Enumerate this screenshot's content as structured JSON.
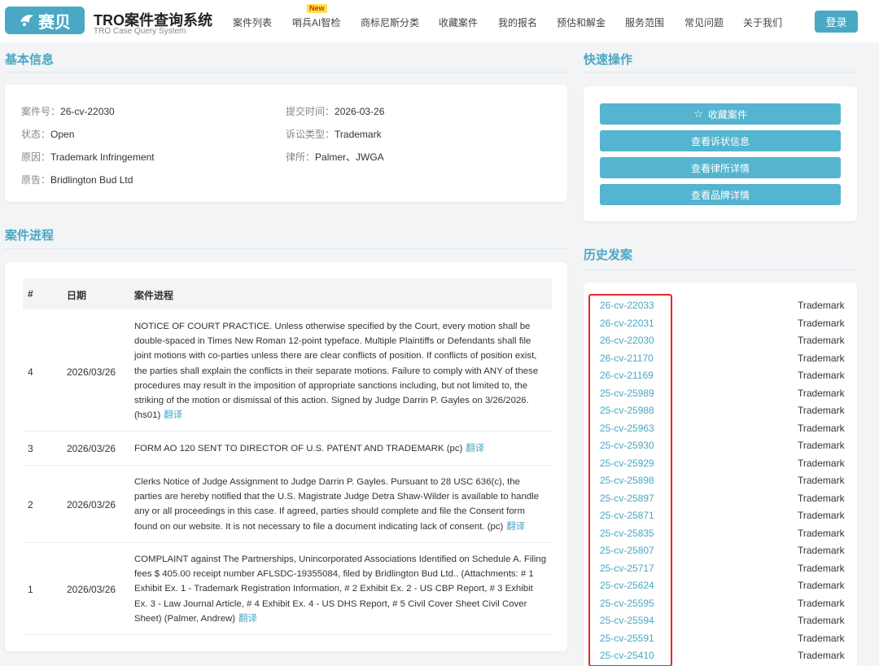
{
  "brand": {
    "logo_text": "赛贝",
    "title": "TRO案件查询系统",
    "subtitle": "TRO Case Query System"
  },
  "nav": {
    "items": [
      "案件列表",
      "哨兵AI智检",
      "商标尼斯分类",
      "收藏案件",
      "我的报名",
      "预估和解金",
      "服务范围",
      "常见问题",
      "关于我们"
    ],
    "new_badge": "New",
    "login": "登录"
  },
  "basic_info": {
    "heading": "基本信息",
    "fields": [
      {
        "label": "案件号：",
        "value": "26-cv-22030"
      },
      {
        "label": "提交时间：",
        "value": "2026-03-26"
      },
      {
        "label": "状态：",
        "value": "Open"
      },
      {
        "label": "诉讼类型：",
        "value": "Trademark"
      },
      {
        "label": "原因：",
        "value": "Trademark Infringement"
      },
      {
        "label": "律所：",
        "value": "Palmer、JWGA"
      },
      {
        "label": "原告：",
        "value": "Bridlington Bud Ltd"
      }
    ]
  },
  "quick_actions": {
    "heading": "快速操作",
    "buttons": [
      "收藏案件",
      "查看诉状信息",
      "查看律所详情",
      "查看品牌详情"
    ]
  },
  "progress": {
    "heading": "案件进程",
    "columns": [
      "#",
      "日期",
      "案件进程"
    ],
    "translate_label": "翻译",
    "rows": [
      {
        "no": "4",
        "date": "2026/03/26",
        "text": "NOTICE OF COURT PRACTICE. Unless otherwise specified by the Court, every motion shall be double-spaced in Times New Roman 12-point typeface. Multiple Plaintiffs or Defendants shall file joint motions with co-parties unless there are clear conflicts of position. If conflicts of position exist, the parties shall explain the conflicts in their separate motions. Failure to comply with ANY of these procedures may result in the imposition of appropriate sanctions including, but not limited to, the striking of the motion or dismissal of this action. Signed by Judge Darrin P. Gayles on 3/26/2026. (hs01)"
      },
      {
        "no": "3",
        "date": "2026/03/26",
        "text": "FORM AO 120 SENT TO DIRECTOR OF U.S. PATENT AND TRADEMARK (pc)"
      },
      {
        "no": "2",
        "date": "2026/03/26",
        "text": "Clerks Notice of Judge Assignment to Judge Darrin P. Gayles. Pursuant to 28 USC 636(c), the parties are hereby notified that the U.S. Magistrate Judge Detra Shaw-Wilder is available to handle any or all proceedings in this case. If agreed, parties should complete and file the Consent form found on our website. It is not necessary to file a document indicating lack of consent. (pc)"
      },
      {
        "no": "1",
        "date": "2026/03/26",
        "text": "COMPLAINT against The Partnerships, Unincorporated Associations Identified on Schedule A. Filing fees $ 405.00 receipt number AFLSDC-19355084, filed by Bridlington Bud Ltd.. (Attachments: # 1 Exhibit Ex. 1 - Trademark Registration Information, # 2 Exhibit Ex. 2 - US CBP Report, # 3 Exhibit Ex. 3 - Law Journal Article, # 4 Exhibit Ex. 4 - US DHS Report, # 5 Civil Cover Sheet Civil Cover Sheet) (Palmer, Andrew)"
      }
    ]
  },
  "history": {
    "heading": "历史发案",
    "items": [
      {
        "case": "26-cv-22033",
        "type": "Trademark"
      },
      {
        "case": "26-cv-22031",
        "type": "Trademark"
      },
      {
        "case": "26-cv-22030",
        "type": "Trademark"
      },
      {
        "case": "26-cv-21170",
        "type": "Trademark"
      },
      {
        "case": "26-cv-21169",
        "type": "Trademark"
      },
      {
        "case": "25-cv-25989",
        "type": "Trademark"
      },
      {
        "case": "25-cv-25988",
        "type": "Trademark"
      },
      {
        "case": "25-cv-25963",
        "type": "Trademark"
      },
      {
        "case": "25-cv-25930",
        "type": "Trademark"
      },
      {
        "case": "25-cv-25929",
        "type": "Trademark"
      },
      {
        "case": "25-cv-25898",
        "type": "Trademark"
      },
      {
        "case": "25-cv-25897",
        "type": "Trademark"
      },
      {
        "case": "25-cv-25871",
        "type": "Trademark"
      },
      {
        "case": "25-cv-25835",
        "type": "Trademark"
      },
      {
        "case": "25-cv-25807",
        "type": "Trademark"
      },
      {
        "case": "25-cv-25717",
        "type": "Trademark"
      },
      {
        "case": "25-cv-25624",
        "type": "Trademark"
      },
      {
        "case": "25-cv-25595",
        "type": "Trademark"
      },
      {
        "case": "25-cv-25594",
        "type": "Trademark"
      },
      {
        "case": "25-cv-25591",
        "type": "Trademark"
      },
      {
        "case": "25-cv-25410",
        "type": "Trademark"
      }
    ]
  },
  "icons": {
    "logo": "bird-logo-icon",
    "favorite": "star-icon"
  },
  "colors": {
    "accent": "#4aa8c4",
    "button": "#55b4cf",
    "highlight_box": "#e32a2a",
    "badge": "#ffe04a"
  }
}
